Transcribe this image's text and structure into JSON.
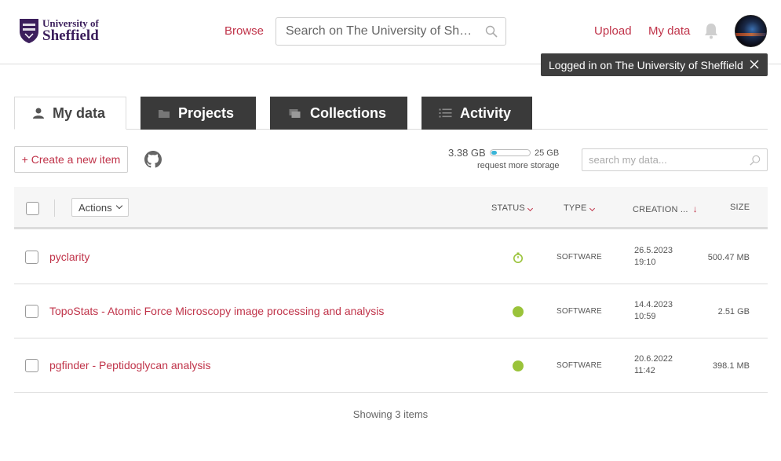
{
  "header": {
    "logo": {
      "line1": "University of",
      "line2": "Sheffield"
    },
    "nav": {
      "browse": "Browse",
      "upload": "Upload",
      "my_data": "My data"
    },
    "search": {
      "placeholder": "Search on The University of Sh…"
    }
  },
  "toast": {
    "message": "Logged in on The University of Sheffield"
  },
  "tabs": [
    {
      "label": "My data",
      "icon": "user-icon",
      "active": true
    },
    {
      "label": "Projects",
      "icon": "folder-icon",
      "active": false
    },
    {
      "label": "Collections",
      "icon": "collections-icon",
      "active": false
    },
    {
      "label": "Activity",
      "icon": "list-icon",
      "active": false
    }
  ],
  "toolbar": {
    "create_label": "+ Create a new item",
    "storage": {
      "used": "3.38 GB",
      "total": "25 GB",
      "used_fraction": 0.135,
      "more": "request more storage"
    },
    "search_placeholder": "search my data..."
  },
  "table": {
    "actions_label": "Actions",
    "columns": {
      "status": "STATUS",
      "type": "TYPE",
      "creation": "CREATION ...",
      "size": "SIZE"
    },
    "rows": [
      {
        "title": "pyclarity",
        "status": "pending",
        "type": "SOFTWARE",
        "date": "26.5.2023",
        "time": "19:10",
        "size": "500.47 MB"
      },
      {
        "title": "TopoStats - Atomic Force Microscopy image processing and analysis",
        "status": "published",
        "type": "SOFTWARE",
        "date": "14.4.2023",
        "time": "10:59",
        "size": "2.51 GB"
      },
      {
        "title": "pgfinder - Peptidoglycan analysis",
        "status": "published",
        "type": "SOFTWARE",
        "date": "20.6.2022",
        "time": "11:42",
        "size": "398.1 MB"
      }
    ],
    "footer": "Showing 3 items"
  },
  "colors": {
    "accent": "#c0344a",
    "status_green": "#9ac33a",
    "tab_dark": "#3a3a3a",
    "logo_purple": "#3c1f5c"
  }
}
